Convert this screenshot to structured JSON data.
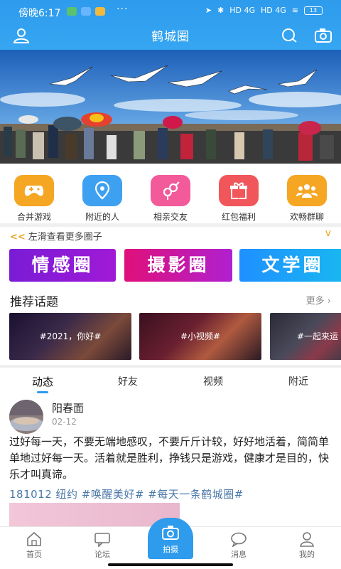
{
  "status_bar": {
    "time": "傍晚6:17",
    "signal1": "HD 4G",
    "signal2": "HD 4G",
    "battery": "13"
  },
  "titlebar": {
    "title": "鹤城圈",
    "icons": [
      "user-icon",
      "search-icon",
      "camera-icon"
    ]
  },
  "quick_links": [
    {
      "label": "合并游戏",
      "icon": "gamepad-icon",
      "color": "#f5a623"
    },
    {
      "label": "附近的人",
      "icon": "location-pin-icon",
      "color": "#3ea0f0"
    },
    {
      "label": "相亲交友",
      "icon": "gender-icon",
      "color": "#f25a9a"
    },
    {
      "label": "红包福利",
      "icon": "gift-icon",
      "color": "#f0565a"
    },
    {
      "label": "欢畅群聊",
      "icon": "group-icon",
      "color": "#f5a623"
    }
  ],
  "swipe_hint": {
    "arrows": "<<",
    "text": "左滑查看更多圈子",
    "caret": "v"
  },
  "circles": [
    {
      "label": "情感圈",
      "color_from": "#7a1bd6",
      "color_to": "#a01ad6"
    },
    {
      "label": "摄影圈",
      "color_from": "#e0107a",
      "color_to": "#b020d0"
    },
    {
      "label": "文学圈",
      "color_from": "#1f90ff",
      "color_to": "#19b8f0"
    }
  ],
  "topics": {
    "title": "推荐话题",
    "more": "更多",
    "items": [
      {
        "label": "#2021，你好#"
      },
      {
        "label": "#小视频#"
      },
      {
        "label": "#一起来运"
      }
    ]
  },
  "feed_tabs": [
    {
      "label": "动态",
      "active": true
    },
    {
      "label": "好友",
      "active": false
    },
    {
      "label": "视频",
      "active": false
    },
    {
      "label": "附近",
      "active": false
    }
  ],
  "post": {
    "author": "阳春面",
    "date": "02-12",
    "body": "过好每一天，不要无端地感叹，不要斤斤计较，好好地活着，简简单单地过好每一天。活着就是胜利，挣钱只是游戏，健康才是目的，快乐才叫真谛。",
    "tags": "181012 纽约 #唤醒美好# #每天一条鹤城圈#"
  },
  "bottom_nav": [
    {
      "label": "首页",
      "icon": "home-icon"
    },
    {
      "label": "论坛",
      "icon": "forum-icon"
    },
    {
      "label": "拍摄",
      "icon": "camera-icon"
    },
    {
      "label": "消息",
      "icon": "message-icon"
    },
    {
      "label": "我的",
      "icon": "profile-icon"
    }
  ],
  "colors": {
    "brand": "#2e9bec",
    "hint": "#e8a320",
    "tag": "#4a77a8"
  }
}
